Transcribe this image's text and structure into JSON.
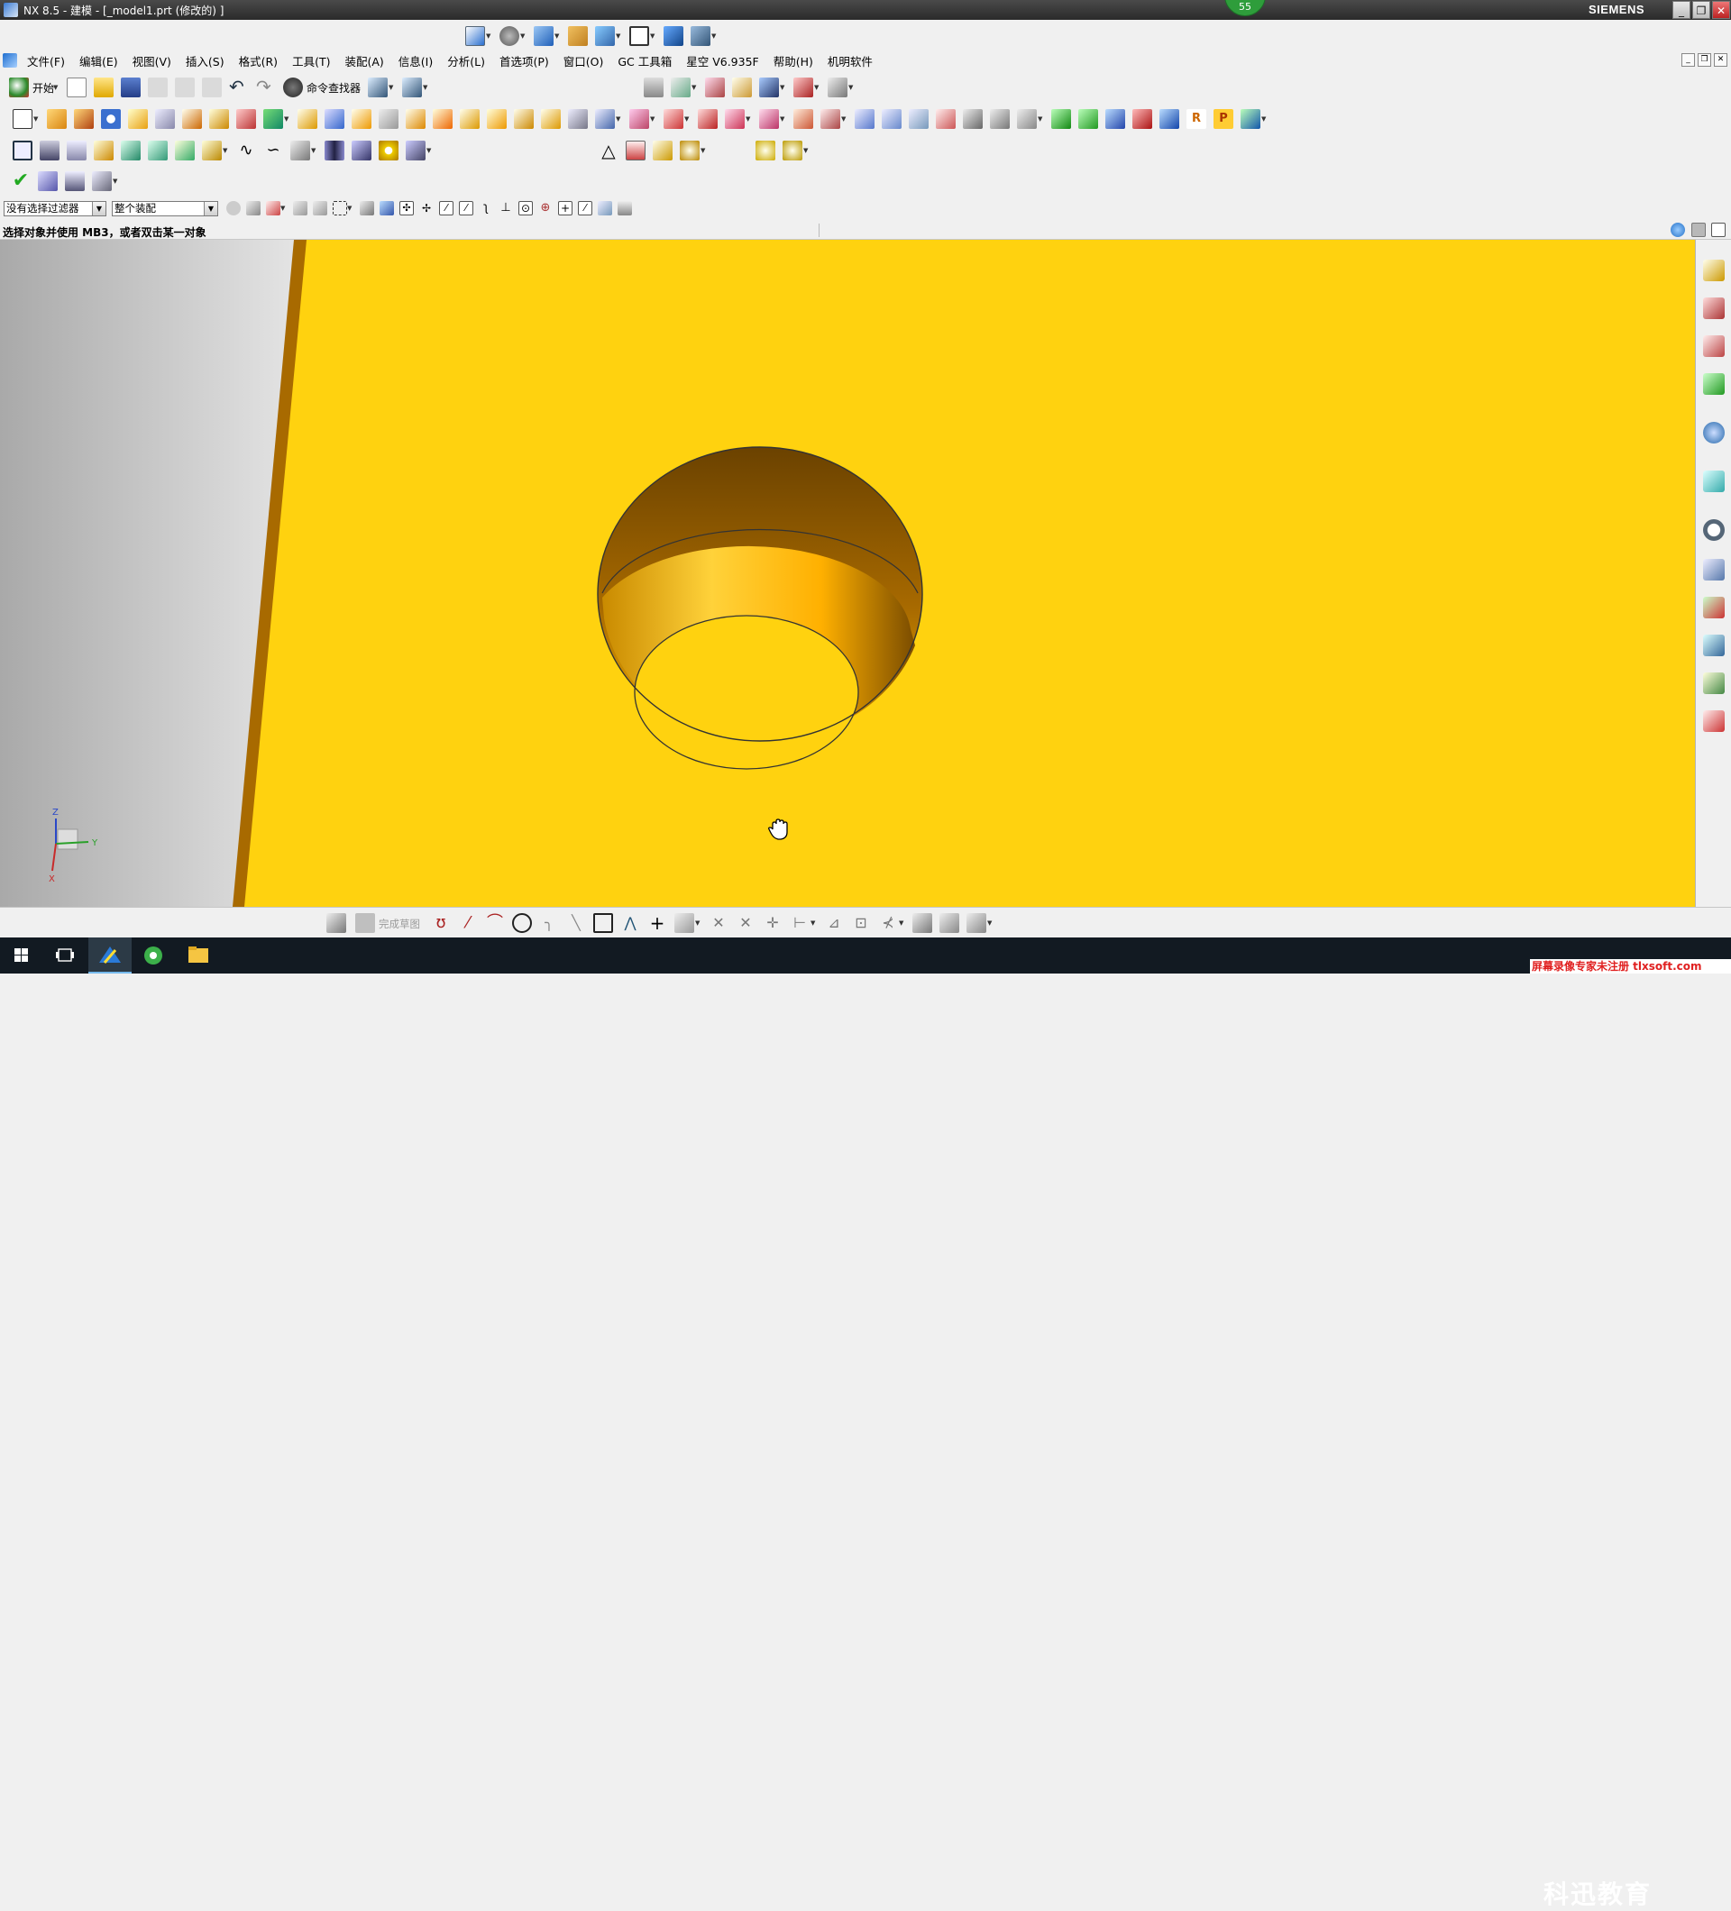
{
  "window": {
    "title": "NX 8.5 - 建模 - [_model1.prt (修改的) ]",
    "brand": "SIEMENS",
    "badge": "55",
    "controls": [
      "_",
      "❐",
      "✕"
    ]
  },
  "menubar": {
    "items": [
      "文件(F)",
      "编辑(E)",
      "视图(V)",
      "插入(S)",
      "格式(R)",
      "工具(T)",
      "装配(A)",
      "信息(I)",
      "分析(L)",
      "首选项(P)",
      "窗口(O)",
      "GC 工具箱",
      "星空 V6.935F",
      "帮助(H)",
      "机明软件"
    ]
  },
  "toolbar": {
    "start_label": "开始",
    "command_finder_label": "命令查找器"
  },
  "selection": {
    "filter_value": "没有选择过滤器",
    "scope_value": "整个装配"
  },
  "status": {
    "prompt": "选择对象并使用 MB3，或者双击某一对象"
  },
  "sketch": {
    "finish_label": "完成草图"
  },
  "triad": {
    "x": "X",
    "y": "Y",
    "z": "Z"
  },
  "overlay": {
    "logo": "科迅教育",
    "watermark": "屏幕录像专家未注册 tlxsoft.com"
  },
  "colors": {
    "body": "#ffd20f",
    "hole_dark": "#6b4200",
    "edge": "#c98a00"
  }
}
